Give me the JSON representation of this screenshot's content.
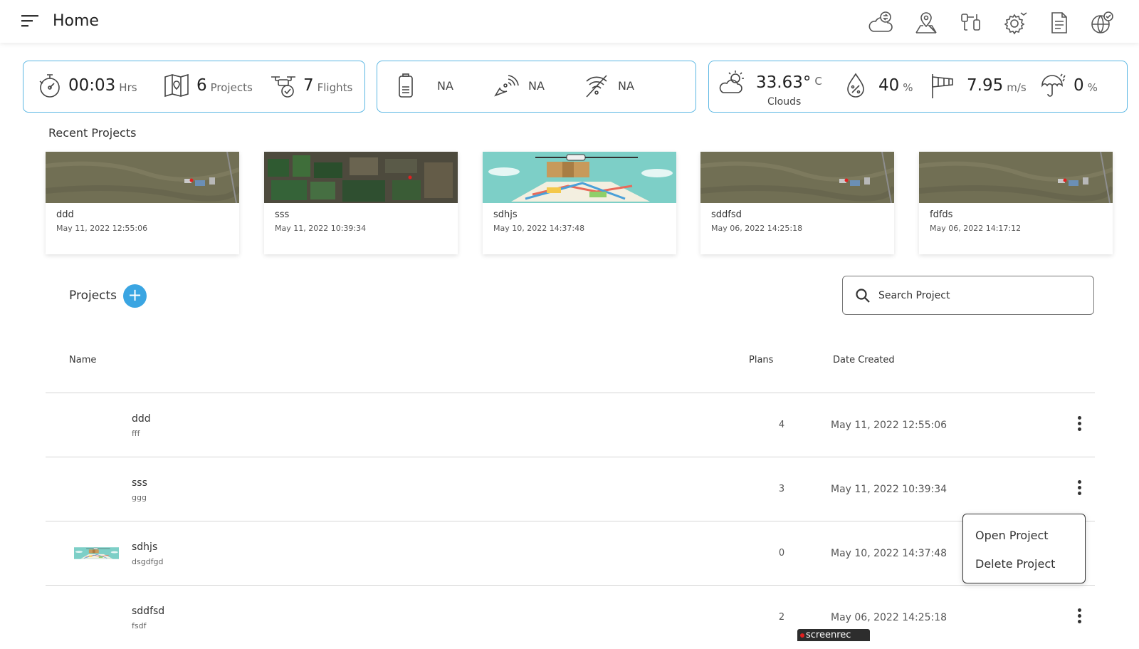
{
  "header": {
    "title": "Home",
    "icons": [
      "cloud-sync-icon",
      "map-pin-icon",
      "drone-controller-icon",
      "settings-gear-icon",
      "document-icon",
      "globe-check-icon"
    ]
  },
  "stats": {
    "flight_time": "00:03",
    "flight_time_unit": "Hrs",
    "projects_count": "6",
    "projects_label": "Projects",
    "flights_count": "7",
    "flights_label": "Flights"
  },
  "device": {
    "battery": "NA",
    "signal": "NA",
    "link": "NA"
  },
  "weather": {
    "temperature": "33.63°",
    "temperature_unit": "C",
    "condition": "Clouds",
    "humidity": "40",
    "humidity_unit": "%",
    "wind": "7.95",
    "wind_unit": "m/s",
    "rain": "0",
    "rain_unit": "%"
  },
  "recent": {
    "title": "Recent Projects",
    "items": [
      {
        "name": "ddd",
        "date": "May 11, 2022  12:55:06",
        "thumb": "aerial-field"
      },
      {
        "name": "sss",
        "date": "May 11, 2022  10:39:34",
        "thumb": "aerial-farmland"
      },
      {
        "name": "sdhjs",
        "date": "May 10, 2022  14:37:48",
        "thumb": "drone-map"
      },
      {
        "name": "sddfsd",
        "date": "May 06, 2022  14:25:18",
        "thumb": "aerial-field"
      },
      {
        "name": "fdfds",
        "date": "May 06, 2022  14:17:12",
        "thumb": "aerial-field"
      }
    ]
  },
  "projects": {
    "title": "Projects",
    "add_label": "+",
    "search_placeholder": "Search Project",
    "columns": {
      "name": "Name",
      "plans": "Plans",
      "date": "Date Created"
    },
    "rows": [
      {
        "name": "ddd",
        "desc": "fff",
        "plans": "4",
        "date": "May 11, 2022  12:55:06"
      },
      {
        "name": "sss",
        "desc": "ggg",
        "plans": "3",
        "date": "May 11, 2022  10:39:34"
      },
      {
        "name": "sdhjs",
        "desc": "dsgdfgd",
        "plans": "0",
        "date": "May 10, 2022  14:37:48"
      },
      {
        "name": "sddfsd",
        "desc": "fsdf",
        "plans": "2",
        "date": "May 06, 2022  14:25:18"
      }
    ]
  },
  "context_menu": {
    "open": "Open Project",
    "delete": "Delete Project"
  },
  "watermark": {
    "text": "screenrec"
  },
  "colors": {
    "accent": "#3aa5e2",
    "card_border": "#5bb7e3"
  }
}
